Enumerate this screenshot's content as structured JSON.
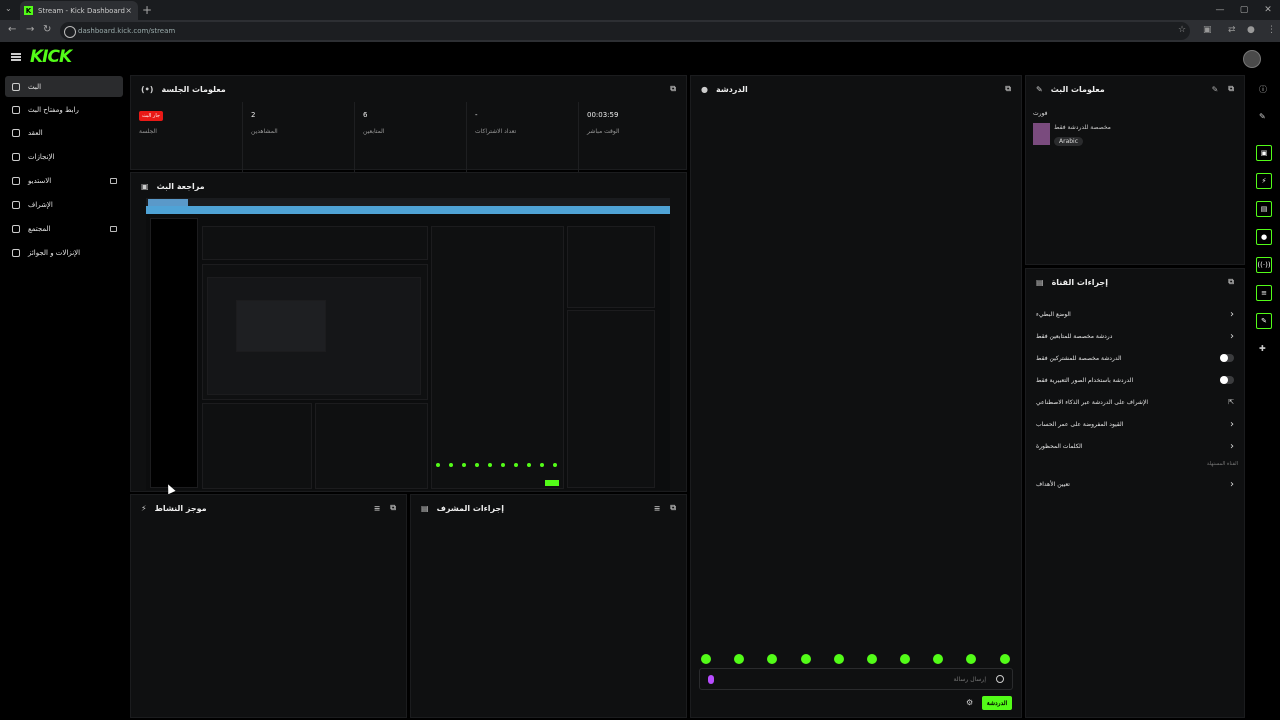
{
  "browser": {
    "tab_title": "Stream - Kick Dashboard",
    "tab_favicon": "K",
    "tab_close": "×",
    "new_tab": "+",
    "url": "dashboard.kick.com/stream",
    "window_controls": [
      "—",
      "▢",
      "✕"
    ]
  },
  "app": {
    "logo": "KICK"
  },
  "sidebar": {
    "items": [
      {
        "label": "البث",
        "icon": "broadcast-icon"
      },
      {
        "label": "رابط ومفتاح البث",
        "icon": "key-icon"
      },
      {
        "label": "العقد",
        "icon": "contract-icon"
      },
      {
        "label": "الإنجازات",
        "icon": "trophy-icon"
      },
      {
        "label": "الاستديو",
        "icon": "studio-icon"
      },
      {
        "label": "الإشراف",
        "icon": "moderation-icon"
      },
      {
        "label": "المجتمع",
        "icon": "community-icon"
      },
      {
        "label": "الإنزالات و الجوائز",
        "icon": "drops-icon"
      }
    ]
  },
  "session": {
    "title": "معلومات الجلسة",
    "live_badge": "جار البث",
    "stats": [
      {
        "value": "",
        "label": "الجلسة"
      },
      {
        "value": "2",
        "label": "المشاهدين"
      },
      {
        "value": "6",
        "label": "المتابعين"
      },
      {
        "value": "-",
        "label": "تعداد الاشتراكات"
      },
      {
        "value": "00:03:59",
        "label": "الوقت مباشر"
      }
    ]
  },
  "preview": {
    "title": "مراجعة البث"
  },
  "activity": {
    "title": "موجز النشاط"
  },
  "mod_actions": {
    "title": "إجراءات المشرف"
  },
  "chat": {
    "title": "الدردشة",
    "input_placeholder": "إرسال رسالة",
    "send_label": "الدردشة"
  },
  "stream_info": {
    "title": "معلومات البث",
    "category": "فورت",
    "category_desc": "مخصصة للدردشة فقط",
    "language_tag": "Arabic"
  },
  "channel_actions": {
    "title": "إجراءات القناة",
    "rows": [
      {
        "label": "الوضع البطيء",
        "control": "chevron"
      },
      {
        "label": "دردشة مخصصة للمتابعين فقط",
        "control": "chevron"
      },
      {
        "label": "الدردشة مخصصة للمشتركين فقط",
        "control": "toggle"
      },
      {
        "label": "الدردشة باستخدام الصور التعبيرية فقط",
        "control": "toggle"
      },
      {
        "label": "الإشراف على الدردشة عبر الذكاء الاصطناعي",
        "control": "link"
      },
      {
        "label": "القيود المفروضة على عمر الحساب",
        "control": "chevron"
      },
      {
        "label": "الكلمات المحظورة",
        "control": "chevron"
      }
    ],
    "section_note": "القناة المستهلة",
    "goals": "تعيين الأهداف"
  },
  "colors": {
    "accent": "#53fc18",
    "live": "#e91916",
    "bg": "#000000",
    "panel": "#0f1011"
  }
}
